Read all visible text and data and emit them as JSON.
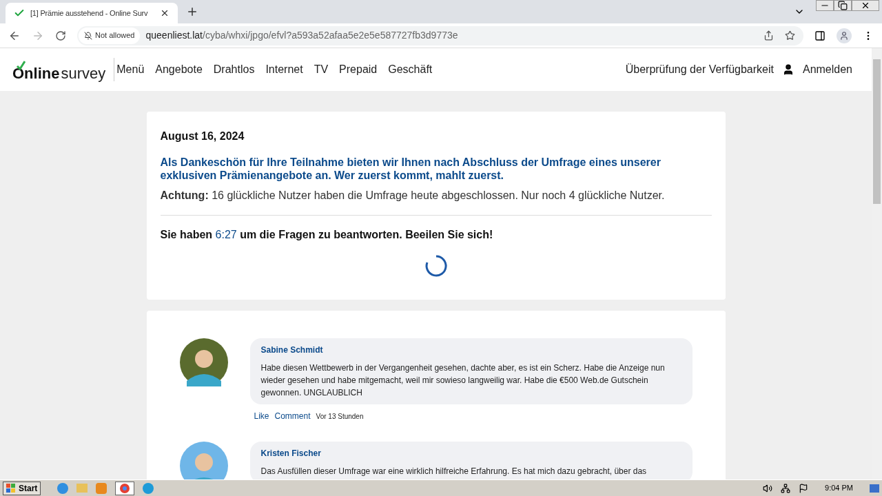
{
  "browser": {
    "tab": {
      "title": "[1] Prämie ausstehend - Online Surv"
    },
    "site_info": "Not allowed",
    "url_host": "queenliest.lat",
    "url_path": "/cyba/whxi/jpgo/efvl?a593a52afaa5e2e5e587727fb3d9773e"
  },
  "site": {
    "logo_bold": "Online",
    "logo_light": "survey",
    "nav": [
      "Menü",
      "Angebote",
      "Drahtlos",
      "Internet",
      "TV",
      "Prepaid",
      "Geschäft"
    ],
    "availability": "Überprüfung der Verfügbarkeit",
    "login": "Anmelden"
  },
  "card": {
    "date": "August 16, 2024",
    "headline": "Als Dankeschön für Ihre Teilnahme bieten wir Ihnen nach Abschluss der Umfrage eines unserer exklusiven Prämienangebote an. Wer zuerst kommt, mahlt zuerst.",
    "notice": "**Achtung:** 16 glückliche Nutzer haben die Umfrage heute abgeschlossen. Nur noch 4 glückliche Nutzer.",
    "timer_before": "Sie haben",
    "timer": "6:27",
    "timer_after": "um die Fragen zu beantworten. Beeilen Sie sich!"
  },
  "comments": [
    {
      "name": "Sabine Schmidt",
      "text": "Habe diesen Wettbewerb in der Vergangenheit gesehen, dachte aber, es ist ein Scherz. Habe die Anzeige nun wieder gesehen und habe mitgemacht, weil mir sowieso langweilig war. Habe die €500 Web.de Gutschein gewonnen. UNGLAUBLICH",
      "like": "Like",
      "comment": "Comment",
      "time": "Vor 13 Stunden"
    },
    {
      "name": "Kristen Fischer",
      "text": "Das Ausfüllen dieser Umfrage war eine wirklich hilfreiche Erfahrung. Es hat mich dazu gebracht, über das"
    }
  ],
  "taskbar": {
    "start": "Start",
    "clock": "9:04 PM"
  }
}
